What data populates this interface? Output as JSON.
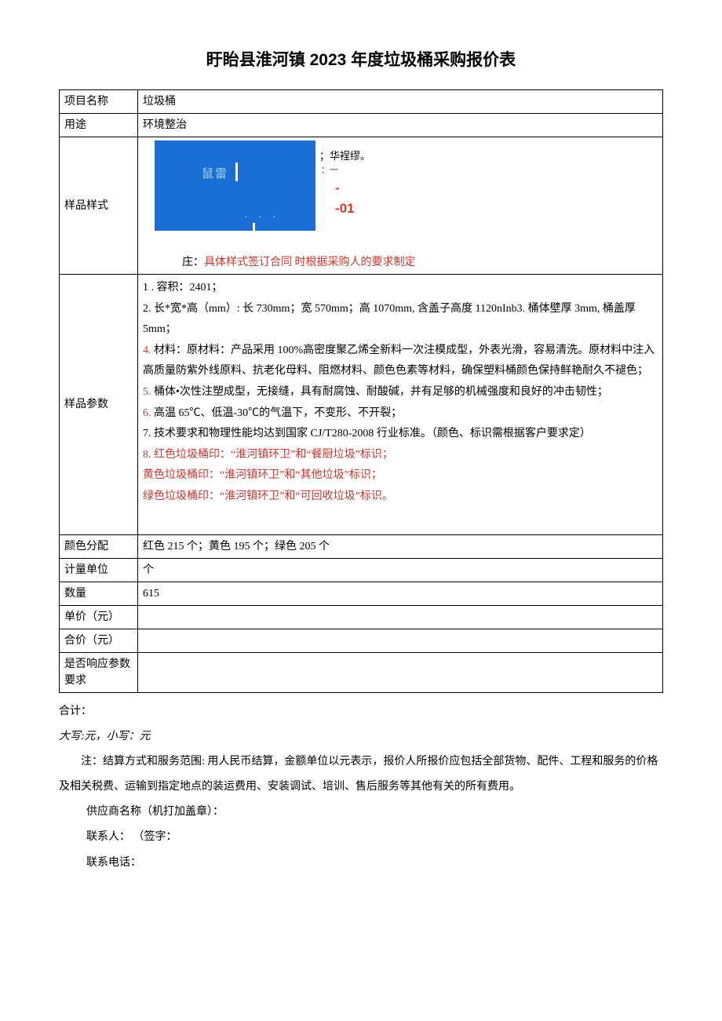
{
  "title": "盱眙县淮河镇 2023 年度垃圾桶采购报价表",
  "rows": {
    "projectName": {
      "label": "项目名称",
      "value": "垃圾桶"
    },
    "usage": {
      "label": "用途",
      "value": "环境整治"
    },
    "sampleStyle": {
      "label": "样品样式",
      "img": {
        "text1": "鼠雷",
        "side1": "；华裎缪。",
        "side2": "：一",
        "code": "--01"
      },
      "noteBlack": "庄：",
      "noteRed": "具体样式签订合同   时根据采购人的要求制定"
    },
    "sampleParams": {
      "label": "样品参数",
      "lines": [
        {
          "text": "1         . 容积：2401；",
          "red": false
        },
        {
          "text": "2. 长*宽*高（mm）: 长 730mm；宽 570mm；高 1070mm, 含盖子高度 1120nInb3. 桶体壁厚 3mm, 桶盖厚5mm；",
          "red": false
        },
        {
          "text": "4. 材料：原材料：产品采用 100%高密度聚乙烯全新料一次注模成型，外表光滑，容易清洗。原材料中注入高质量防紫外线原料、抗老化母料、阻燃材料、颜色色素等材料，确保塑料桶颜色保持鲜艳耐久不褪色；",
          "red": true,
          "prefixRedLen": 2
        },
        {
          "text": "5. 桶体•次性注塑成型，无接缝，具有耐腐蚀、耐酸碱，并有足够的机械强度和良好的冲击韧性；",
          "red": true,
          "prefixRedLen": 2
        },
        {
          "text": "6. 高温 65℃、低温-30℃的气温下，不变形、不开裂；",
          "red": true,
          "prefixRedLen": 2
        },
        {
          "text": "7. 技术要求和物理性能均达到国家 CJ/T280-2008 行业标准。（颜色、标识需根据客户要求定）",
          "red": false
        },
        {
          "text": "8. 红色垃圾桶印：“淮河镇环卫”和“餐厨垃圾”标识；",
          "red": true,
          "allRed": true
        },
        {
          "text": "    黄色垃圾桶印：“淮河镇环卫”和“其他垃圾”标识；",
          "red": true,
          "allRed": true
        },
        {
          "text": "    绿色垃圾桶印：“淮河镇环卫”和“可回收垃圾”标识。",
          "red": true,
          "allRed": true
        }
      ]
    },
    "colorDist": {
      "label": "颜色分配",
      "value": "红色 215 个；黄色 195 个；绿色 205 个"
    },
    "unit": {
      "label": "计量单位",
      "value": "个"
    },
    "qty": {
      "label": "数量",
      "value": "615"
    },
    "unitPrice": {
      "label": "单价（元）",
      "value": ""
    },
    "totalPrice": {
      "label": "合价（元）",
      "value": ""
    },
    "respond": {
      "label": "是否响应参数要求",
      "value": ""
    }
  },
  "footer": {
    "total": "合计：",
    "amount": "大写:元，小写：元",
    "note": "注：结算方式和服务范围: 用人民币结算，金额单位以元表示，报价人所报价应包括全部货物、配件、工程和服务的价格及相关税费、运输到指定地点的装运费用、安装调试、培训、售后服务等其他有关的所有费用。",
    "supplier": "供应商名称（机打加盖章）：",
    "contact": "联系人：        （签字：",
    "phone": "联系电话："
  }
}
